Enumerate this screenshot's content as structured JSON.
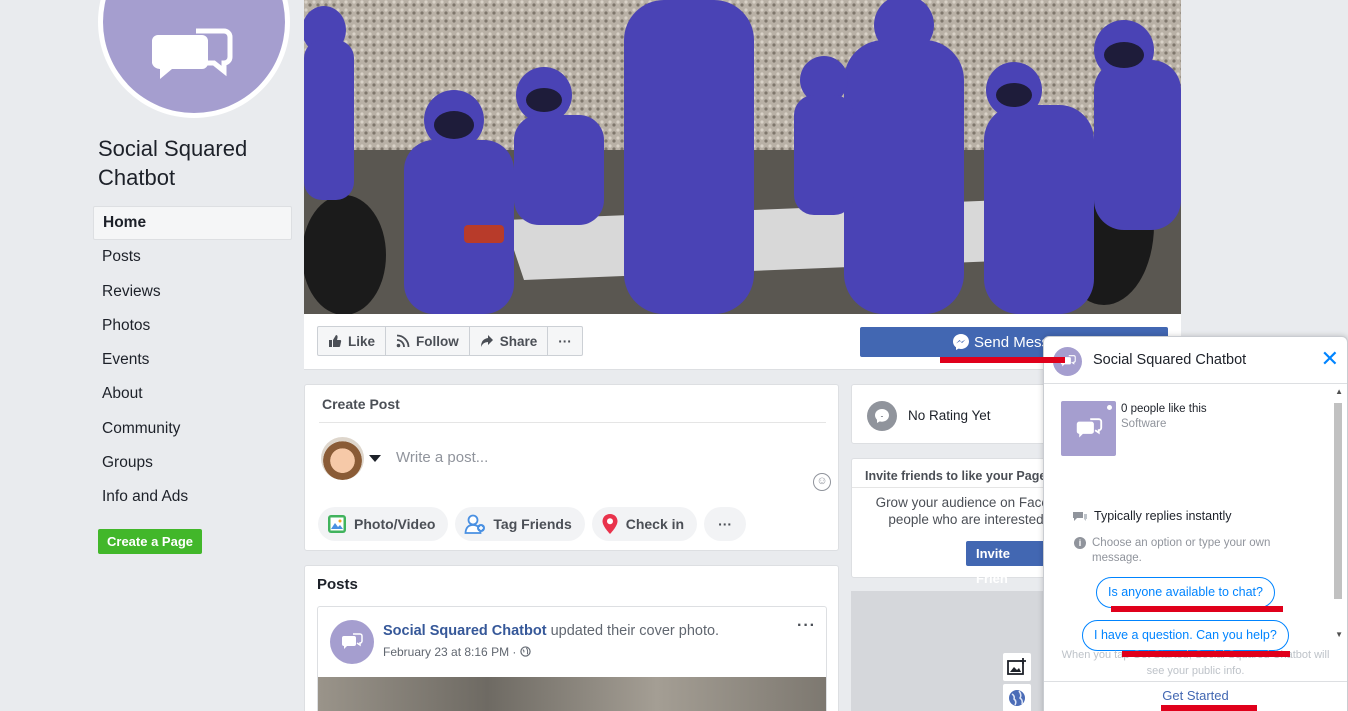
{
  "page": {
    "name": "Social Squared Chatbot",
    "create_page_label": "Create a Page"
  },
  "nav": {
    "items": [
      {
        "label": "Home",
        "active": true
      },
      {
        "label": "Posts"
      },
      {
        "label": "Reviews"
      },
      {
        "label": "Photos"
      },
      {
        "label": "Events"
      },
      {
        "label": "About"
      },
      {
        "label": "Community"
      },
      {
        "label": "Groups"
      },
      {
        "label": "Info and Ads"
      }
    ]
  },
  "actions": {
    "like": "Like",
    "follow": "Follow",
    "share": "Share",
    "more": "···",
    "send_message": "Send Mess"
  },
  "create_post": {
    "title": "Create Post",
    "placeholder": "Write a post...",
    "buttons": {
      "photo_video": "Photo/Video",
      "tag_friends": "Tag Friends",
      "check_in": "Check in",
      "more": "···"
    }
  },
  "posts": {
    "title": "Posts",
    "item": {
      "author": "Social Squared Chatbot",
      "action": "updated their cover photo.",
      "time": "February 23 at 8:16 PM ·",
      "more": "···"
    }
  },
  "rating": {
    "text": "No Rating Yet"
  },
  "invite": {
    "title": "Invite friends to like your Page",
    "line1": "Grow your audience on Faceb",
    "line2": "people who are interested",
    "button": "Invite Frien"
  },
  "chat": {
    "title": "Social Squared Chatbot",
    "likes": "0 people like this",
    "category": "Software",
    "replies": "Typically replies instantly",
    "hint": "Choose an option or type your own message.",
    "quick_replies": [
      "Is anyone available to chat?",
      "I have a question. Can you help?"
    ],
    "footer_note_1": "When you tap  Get Started, Social Squared Chatbot will",
    "footer_note_2": "see your public info.",
    "get_started": "Get Started"
  },
  "colors": {
    "brand_blue": "#4267b2",
    "messenger_blue": "#0084ff",
    "page_purple": "#a59ecf",
    "create_green": "#42b72a",
    "annotation_red": "#e0001b"
  }
}
